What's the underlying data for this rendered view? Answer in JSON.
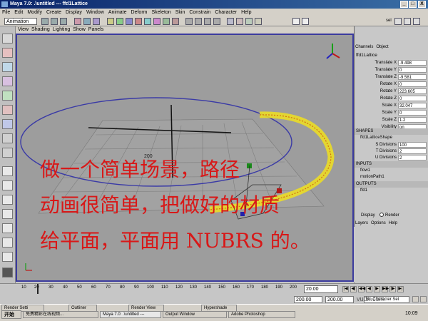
{
  "window": {
    "title": "Maya 7.0: .\\untitled   ---   ffd1Lattice",
    "controls": [
      "_",
      "□",
      "X"
    ]
  },
  "menu": [
    "File",
    "Edit",
    "Modify",
    "Create",
    "Display",
    "Window",
    "Animate",
    "Deform",
    "Skeleton",
    "Skin",
    "Constrain",
    "Character",
    "Help"
  ],
  "shelf": {
    "menuset": "Animation",
    "label": "sel"
  },
  "panel_menu": [
    "View",
    "Shading",
    "Lighting",
    "Show",
    "Panels"
  ],
  "viewport": {
    "grid_label": "200",
    "camera": "persp"
  },
  "overlay_text": [
    "做一个简单场景，路径",
    "动画很简单，把做好的材质",
    "给平面，平面用 NUBRS 的。"
  ],
  "channels": {
    "tabs": [
      "Channels",
      "Object"
    ],
    "object_name": "ffd1Lattice",
    "attrs": [
      {
        "label": "Translate X",
        "value": "-9.498"
      },
      {
        "label": "Translate Y",
        "value": "0"
      },
      {
        "label": "Translate Z",
        "value": "-9.581"
      },
      {
        "label": "Rotate X",
        "value": "0"
      },
      {
        "label": "Rotate Y",
        "value": "223.605"
      },
      {
        "label": "Rotate Z",
        "value": "0"
      },
      {
        "label": "Scale X",
        "value": "32.047"
      },
      {
        "label": "Scale Y",
        "value": "0"
      },
      {
        "label": "Scale Z",
        "value": "1.2"
      },
      {
        "label": "Visibility",
        "value": "on"
      }
    ],
    "shapes_header": "SHAPES",
    "shape_name": "ffd1LatticeShape",
    "divisions": [
      {
        "label": "S Divisions",
        "value": "100"
      },
      {
        "label": "T Divisions",
        "value": "2"
      },
      {
        "label": "U Divisions",
        "value": "2"
      }
    ],
    "inputs_header": "INPUTS",
    "inputs": [
      "flow1",
      "motionPath1"
    ],
    "outputs_header": "OUTPUTS",
    "outputs": [
      "ffd1"
    ]
  },
  "layers": {
    "display": "Display",
    "render": "Render",
    "menu": [
      "Layers",
      "Options",
      "Help"
    ]
  },
  "timeline": {
    "ticks": [
      "10",
      "20",
      "30",
      "40",
      "50",
      "60",
      "70",
      "80",
      "90",
      "100",
      "110",
      "120",
      "130",
      "140",
      "150",
      "160",
      "170",
      "180",
      "190",
      "200"
    ],
    "current": "20.00"
  },
  "range": {
    "start": "200.00",
    "end": "200.00",
    "no_char": "No Character Set"
  },
  "taskbar": {
    "start": "开始",
    "tabs": [
      "Render Setti",
      "Outliner",
      "Render View",
      "Hypershade",
      "Maya 7.0: .\\untitled ---",
      "Output Window",
      "Adobe Photoshop",
      "免费精彩在线视频..."
    ],
    "clock": "10:09"
  },
  "watermark": "vudn.com",
  "colors": {
    "title_start": "#0a246a",
    "viewport_border": "#3b3b9e",
    "overlay_text": "#d81818",
    "lattice": "#f0e020"
  }
}
